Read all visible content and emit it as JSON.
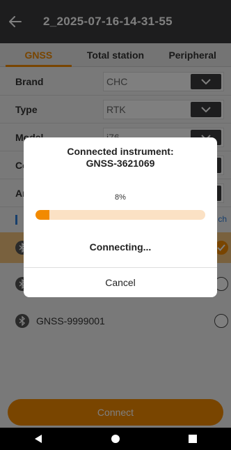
{
  "header": {
    "title": "2_2025-07-16-14-31-55",
    "back_icon": "arrow-left-icon"
  },
  "tabs": [
    {
      "label": "GNSS",
      "active": true
    },
    {
      "label": "Total station",
      "active": false
    },
    {
      "label": "Peripheral",
      "active": false
    }
  ],
  "form": {
    "rows": [
      {
        "label": "Brand",
        "value": "CHC"
      },
      {
        "label": "Type",
        "value": "RTK"
      },
      {
        "label": "Model",
        "value": "i76"
      },
      {
        "label": "Co",
        "value": ""
      },
      {
        "label": "An",
        "value": ""
      }
    ]
  },
  "search": {
    "link_text": "ch"
  },
  "devices": [
    {
      "name": "",
      "selected": true
    },
    {
      "name": "",
      "selected": false
    },
    {
      "name": "GNSS-9999001",
      "selected": false
    }
  ],
  "connect_button": {
    "label": "Connect"
  },
  "dialog": {
    "title_line1": "Connected instrument:",
    "title_line2": "GNSS-3621069",
    "progress_text": "8%",
    "progress_value": 8,
    "status": "Connecting...",
    "cancel_label": "Cancel"
  },
  "colors": {
    "accent": "#f28a00",
    "header_bg": "#3a3a3c",
    "selected_row": "#f3c37d",
    "link": "#2f7fd8"
  }
}
